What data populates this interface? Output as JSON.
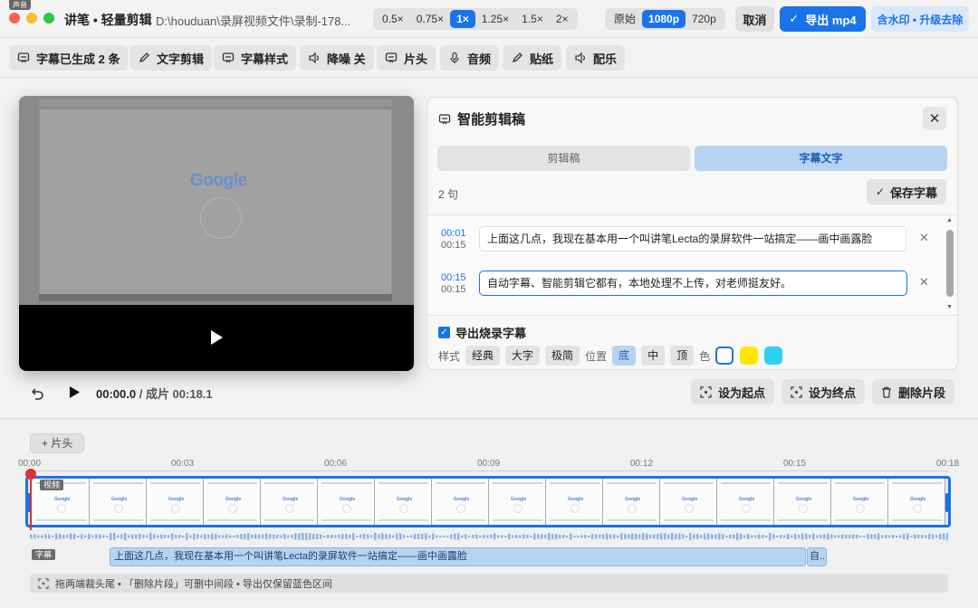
{
  "window": {
    "corner_tag": "声音",
    "app_title": "讲笔 • 轻量剪辑",
    "file_path": "D:\\houduan\\录屏视频文件\\录制-178...",
    "traffic_colors": [
      "#ff5f57",
      "#febc2e",
      "#28c840"
    ]
  },
  "speed": {
    "options": [
      "0.5×",
      "0.75×",
      "1×",
      "1.25×",
      "1.5×",
      "2×"
    ],
    "selected": "1×"
  },
  "resolution": {
    "options": [
      "原始",
      "1080p",
      "720p"
    ],
    "selected": "1080p"
  },
  "header_buttons": {
    "cancel": "取消",
    "export": "导出 mp4",
    "watermark": "含水印 • 升级去除"
  },
  "toolbar": [
    {
      "icon": "subtitle-icon",
      "label": "字幕已生成 2 条"
    },
    {
      "icon": "pencil-icon",
      "label": "文字剪辑"
    },
    {
      "icon": "subtitle-icon",
      "label": "字幕样式"
    },
    {
      "icon": "speaker-icon",
      "label": "降噪 关"
    },
    {
      "icon": "subtitle-icon",
      "label": "片头"
    },
    {
      "icon": "mic-icon",
      "label": "音频"
    },
    {
      "icon": "pencil-icon",
      "label": "贴纸"
    },
    {
      "icon": "speaker-icon",
      "label": "配乐"
    }
  ],
  "player": {
    "preview_logo": "Google",
    "current_time": "00:00.0",
    "total_time_text": "/ 成片 00:18.1"
  },
  "panel": {
    "title": "智能剪辑稿",
    "tabs": [
      "剪辑稿",
      "字幕文字"
    ],
    "active_tab": "字幕文字",
    "count": "2 句",
    "save_button": "保存字幕",
    "subtitles": [
      {
        "start": "00:01",
        "end": "00:15",
        "text": "上面这几点，我现在基本用一个叫讲笔Lecta的录屏软件一站搞定——画中画露脸"
      },
      {
        "start": "00:15",
        "end": "00:15",
        "text": "自动字幕、智能剪辑它都有，本地处理不上传，对老师挺友好。"
      }
    ],
    "export_burn": {
      "label": "导出烧录字幕",
      "checked": true
    },
    "style_label": "样式",
    "styles": [
      "经典",
      "大字",
      "极简"
    ],
    "position_label": "位置",
    "positions": [
      "底",
      "中",
      "顶"
    ],
    "position_selected": "底",
    "color_label": "色",
    "colors": [
      "#ffffff",
      "#ffe600",
      "#2ed1ee"
    ]
  },
  "actions": {
    "set_start": "设为起点",
    "set_end": "设为终点",
    "delete": "删除片段"
  },
  "timeline": {
    "intro_button": "+ 片头",
    "ticks": [
      "00:00",
      "00:03",
      "00:06",
      "00:09",
      "00:12",
      "00:15",
      "00:18"
    ],
    "video_label": "视频",
    "subtitle_label": "字幕",
    "thumbnail_logo": "Google",
    "subtitle_clips": [
      "上面这几点，我现在基本用一个叫讲笔Lecta的录屏软件一站搞定——画中画露脸",
      "自.."
    ],
    "hint": "拖两端裁头尾 • 「删除片段」可删中间段 • 导出仅保留蓝色区间"
  }
}
